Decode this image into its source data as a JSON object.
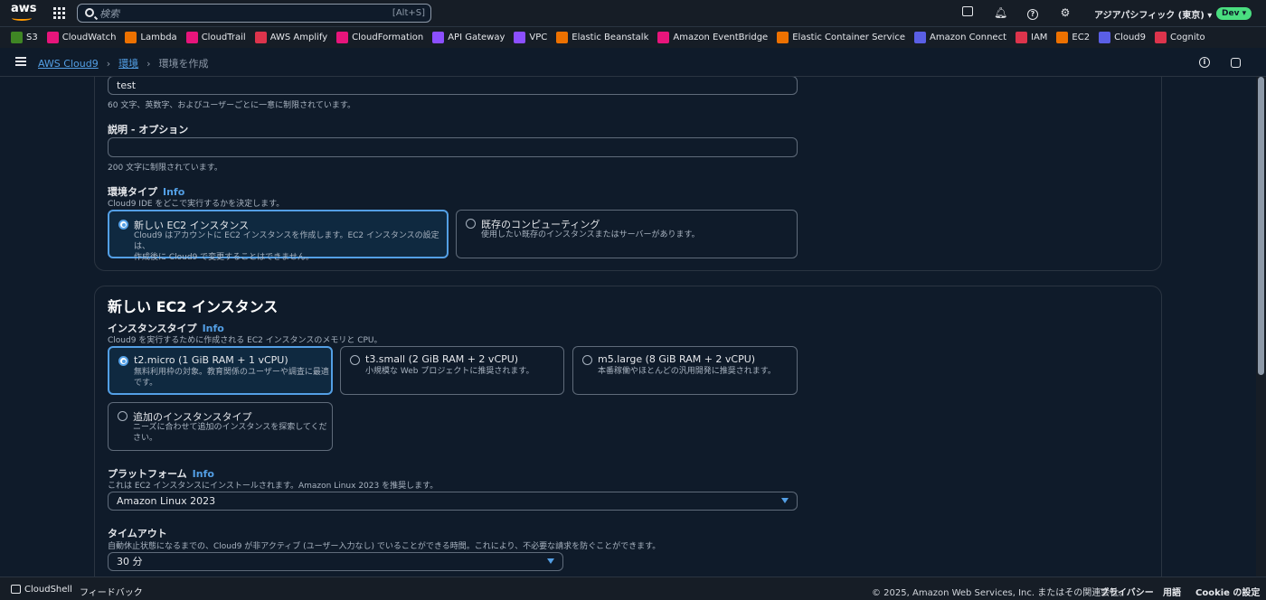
{
  "topbar": {
    "search_placeholder": "検索",
    "search_shortcut": "[Alt+S]",
    "region": "アジアパシフィック (東京) ▾",
    "account_badge": "Dev ▾"
  },
  "favorites": [
    {
      "label": "S3",
      "color": "#3f8624"
    },
    {
      "label": "CloudWatch",
      "color": "#e7157b"
    },
    {
      "label": "Lambda",
      "color": "#ed7100"
    },
    {
      "label": "CloudTrail",
      "color": "#e7157b"
    },
    {
      "label": "AWS Amplify",
      "color": "#dd344c"
    },
    {
      "label": "CloudFormation",
      "color": "#e7157b"
    },
    {
      "label": "API Gateway",
      "color": "#8c4fff"
    },
    {
      "label": "VPC",
      "color": "#8c4fff"
    },
    {
      "label": "Elastic Beanstalk",
      "color": "#ed7100"
    },
    {
      "label": "Amazon EventBridge",
      "color": "#e7157b"
    },
    {
      "label": "Elastic Container Service",
      "color": "#ed7100"
    },
    {
      "label": "Amazon Connect",
      "color": "#5a5fe5"
    },
    {
      "label": "IAM",
      "color": "#dd344c"
    },
    {
      "label": "EC2",
      "color": "#ed7100"
    },
    {
      "label": "Cloud9",
      "color": "#5a5fe5"
    },
    {
      "label": "Cognito",
      "color": "#dd344c"
    }
  ],
  "breadcrumb": {
    "root": "AWS Cloud9",
    "parent": "環境",
    "current": "環境を作成"
  },
  "details": {
    "name_value": "test",
    "name_hint": "60 文字、英数字、およびユーザーごとに一意に制限されています。",
    "description_label": "説明 - オプション",
    "description_hint": "200 文字に制限されています。",
    "env_type_label": "環境タイプ",
    "info": "Info",
    "env_type_hint": "Cloud9 IDE をどこで実行するかを決定します。",
    "env_options": [
      {
        "title": "新しい EC2 インスタンス",
        "desc1": "Cloud9 はアカウントに EC2 インスタンスを作成します。EC2 インスタンスの設定は、",
        "desc2": "作成後に Cloud9 で変更することはできません。"
      },
      {
        "title": "既存のコンピューティング",
        "desc1": "使用したい既存のインスタンスまたはサーバーがあります。",
        "desc2": ""
      }
    ]
  },
  "ec2": {
    "heading": "新しい EC2 インスタンス",
    "instance_type_label": "インスタンスタイプ",
    "info": "Info",
    "instance_type_hint": "Cloud9 を実行するために作成される EC2 インスタンスのメモリと CPU。",
    "instance_options": [
      {
        "title": "t2.micro (1 GiB RAM + 1 vCPU)",
        "desc1": "無料利用枠の対象。教育関係のユーザーや調査に最適",
        "desc2": "です。"
      },
      {
        "title": "t3.small (2 GiB RAM + 2 vCPU)",
        "desc1": "小規模な Web プロジェクトに推奨されます。",
        "desc2": ""
      },
      {
        "title": "m5.large (8 GiB RAM + 2 vCPU)",
        "desc1": "本番稼働やほとんどの汎用開発に推奨されます。",
        "desc2": ""
      },
      {
        "title": "追加のインスタンスタイプ",
        "desc1": "ニーズに合わせて追加のインスタンスを探索してくだ",
        "desc2": "さい。"
      }
    ],
    "platform_label": "プラットフォーム",
    "platform_hint": "これは EC2 インスタンスにインストールされます。Amazon Linux 2023 を推奨します。",
    "platform_value": "Amazon Linux 2023",
    "timeout_label": "タイムアウト",
    "timeout_hint": "自動休止状態になるまでの、Cloud9 が非アクティブ (ユーザー入力なし) でいることができる時間。これにより、不必要な請求を防ぐことができます。",
    "timeout_value": "30 分"
  },
  "footer": {
    "cloudshell": "CloudShell",
    "feedback": "フィードバック",
    "copyright": "© 2025, Amazon Web Services, Inc. またはその関連会社。",
    "privacy": "プライバシー",
    "terms": "用語",
    "cookies": "Cookie の設定"
  }
}
